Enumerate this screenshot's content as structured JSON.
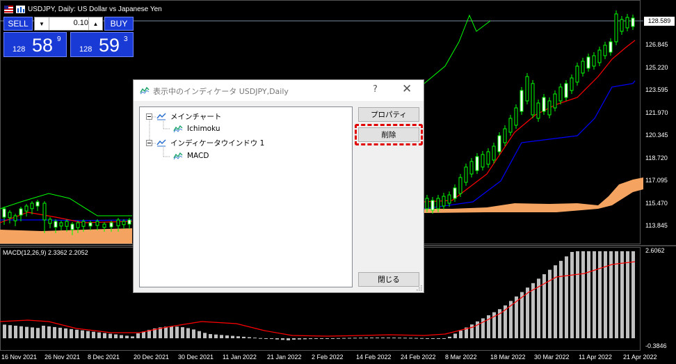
{
  "window": {
    "title": "USDJPY, Daily:  US Dollar vs Japanese Yen"
  },
  "trading_panel": {
    "sell_label": "SELL",
    "buy_label": "BUY",
    "lot_value": "0.10",
    "bid_prefix": "128",
    "bid_big": "58",
    "bid_sup": "9",
    "ask_prefix": "128",
    "ask_big": "59",
    "ask_sup": "3"
  },
  "price_axis": {
    "current_price": "128.589",
    "ticks": [
      "126.845",
      "125.220",
      "123.595",
      "121.970",
      "120.345",
      "118.720",
      "117.095",
      "115.470",
      "113.845"
    ]
  },
  "macd_axis": {
    "top": "2.6062",
    "bottom": "-0.3846"
  },
  "macd_label": "MACD(12,26,9) 2.3362 2.2052",
  "time_axis": [
    "16 Nov 2021",
    "26 Nov 2021",
    "8 Dec 2021",
    "20 Dec 2021",
    "30 Dec 2021",
    "11 Jan 2022",
    "21 Jan 2022",
    "2 Feb 2022",
    "14 Feb 2022",
    "24 Feb 2022",
    "8 Mar 2022",
    "18 Mar 2022",
    "30 Mar 2022",
    "11 Apr 2022",
    "21 Apr 2022"
  ],
  "dialog": {
    "title": "表示中のインディケータ USDJPY,Daily",
    "help": "?",
    "close": "✕",
    "tree": {
      "main_chart": "メインチャート",
      "ichimoku": "Ichimoku",
      "indicator_window": "インディケータウインドウ 1",
      "macd": "MACD"
    },
    "buttons": {
      "properties": "プロパティ",
      "delete": "削除",
      "close": "閉じる"
    }
  },
  "colors": {
    "candle_bull": "#00ff00",
    "tenkan": "#ff0000",
    "kijun": "#0000ff",
    "chikou": "#00ff00",
    "kumo": "#f4a460",
    "macd_hist": "#c0c0c0",
    "macd_signal": "#ff0000",
    "button_blue": "#1a3ad6",
    "highlight_red": "#e00000"
  }
}
